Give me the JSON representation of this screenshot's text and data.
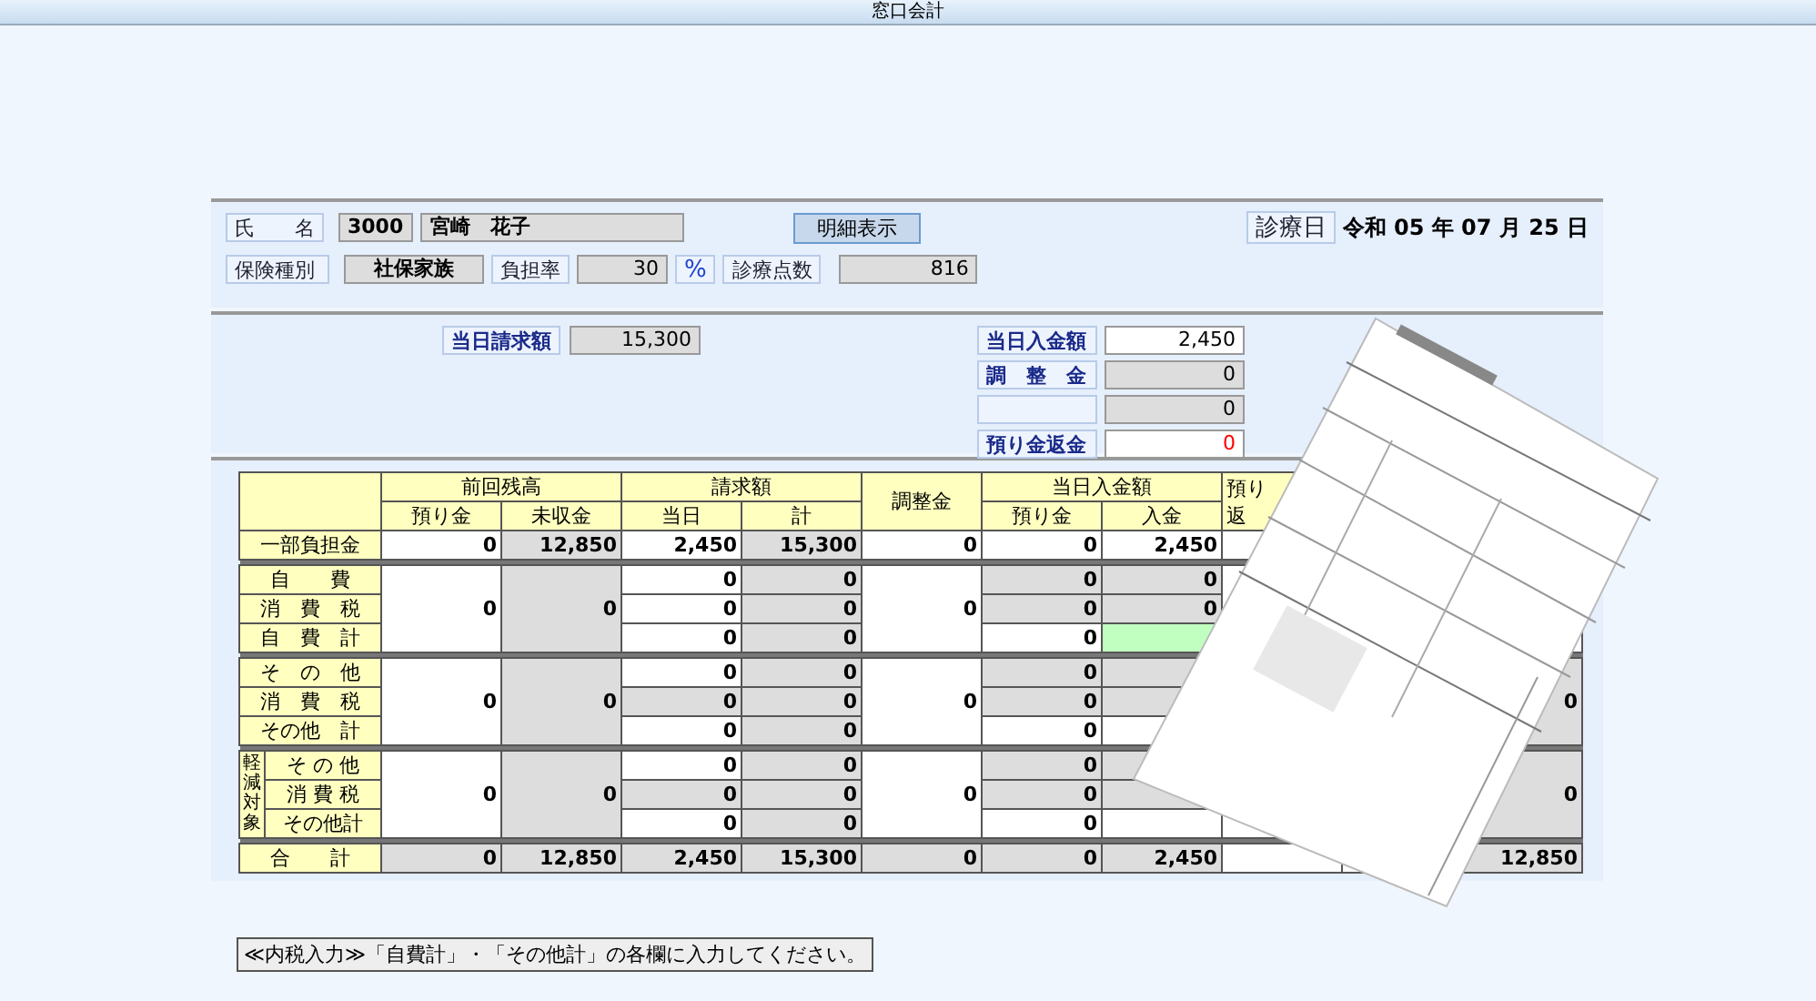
{
  "window": {
    "title": "窓口会計"
  },
  "patient": {
    "name_label": "氏　　名",
    "id": "3000",
    "name": "宮崎　花子",
    "detail_button": "明細表示",
    "date_label": "診療日",
    "date": "令和 05 年 07 月 25 日",
    "insurance_label": "保険種別",
    "insurance": "社保家族",
    "rate_label": "負担率",
    "rate": "30",
    "rate_unit": "%",
    "points_label": "診療点数",
    "points": "816"
  },
  "billing": {
    "label": "当日請求額",
    "value": "15,300"
  },
  "payments": [
    {
      "label": "当日入金額",
      "value": "2,450",
      "editable": true,
      "color": "#000000"
    },
    {
      "label": "調　整　金",
      "value": "0",
      "editable": false,
      "color": "#000000"
    },
    {
      "value": "0",
      "editable": false,
      "color": "#000000"
    },
    {
      "label": "預り金返金",
      "value": "0",
      "editable": true,
      "color": "#ff0000"
    }
  ],
  "table": {
    "header_groups": [
      {
        "label": "前回残高",
        "columns": [
          "預り金",
          "未収金"
        ]
      },
      {
        "label": "請求額",
        "columns": [
          "当日",
          "計"
        ]
      },
      {
        "label": "調整金"
      },
      {
        "label": "当日入金額",
        "columns": [
          "預り金",
          "入金"
        ]
      },
      {
        "lines": [
          "預り",
          "返"
        ]
      }
    ],
    "rows": [
      {
        "kind": "single",
        "label": "一部負担金",
        "cells": [
          {
            "value": "0",
            "shaded": false
          },
          {
            "value": "12,850",
            "shaded": true
          },
          {
            "value": "2,450",
            "shaded": false
          },
          {
            "value": "15,300",
            "shaded": true
          },
          {
            "value": "0",
            "shaded": false
          },
          {
            "value": "0",
            "shaded": false
          },
          {
            "value": "2,450",
            "shaded": false
          },
          null,
          null,
          null
        ]
      },
      {
        "kind": "group",
        "labels": [
          "自　　費",
          "消　費　税",
          "自　費　計"
        ],
        "merged": [
          {
            "value": "0",
            "shaded": false
          },
          {
            "value": "0",
            "shaded": true
          }
        ],
        "adjust": {
          "value": "0",
          "shaded": false
        },
        "lines": [
          [
            {
              "value": "0",
              "shaded": false
            },
            {
              "value": "0",
              "shaded": true
            },
            {
              "value": "0",
              "shaded": true
            },
            {
              "value": "0",
              "shaded": true
            }
          ],
          [
            {
              "value": "0",
              "shaded": false
            },
            {
              "value": "0",
              "shaded": true
            },
            {
              "value": "0",
              "shaded": true
            },
            {
              "value": "0",
              "shaded": true
            }
          ],
          [
            {
              "value": "0",
              "shaded": false
            },
            {
              "value": "0",
              "shaded": true
            },
            {
              "value": "0",
              "shaded": false
            },
            {
              "highlight": true
            }
          ]
        ],
        "end": null
      },
      {
        "kind": "group",
        "labels": [
          "そ　の　他",
          "消　費　税",
          "その他　計"
        ],
        "merged": [
          {
            "value": "0",
            "shaded": false
          },
          {
            "value": "0",
            "shaded": true
          }
        ],
        "adjust": {
          "value": "0",
          "shaded": false
        },
        "lines": [
          [
            {
              "value": "0",
              "shaded": false
            },
            {
              "value": "0",
              "shaded": true
            },
            {
              "value": "0",
              "shaded": true
            },
            {
              "shaded": true
            }
          ],
          [
            {
              "value": "0",
              "shaded": true
            },
            {
              "value": "0",
              "shaded": true
            },
            {
              "value": "0",
              "shaded": true
            },
            {
              "shaded": true
            }
          ],
          [
            {
              "value": "0",
              "shaded": false
            },
            {
              "value": "0",
              "shaded": true
            },
            {
              "value": "0",
              "shaded": false
            },
            {
              "shaded": false
            }
          ]
        ],
        "end": {
          "value": "0",
          "shaded": true
        }
      },
      {
        "kind": "group",
        "side_label": "軽減対象",
        "labels": [
          "そ の 他",
          "消 費 税",
          "その他計"
        ],
        "merged": [
          {
            "value": "0",
            "shaded": false
          },
          {
            "value": "0",
            "shaded": true
          }
        ],
        "adjust": {
          "value": "0",
          "shaded": false
        },
        "lines": [
          [
            {
              "value": "0",
              "shaded": false
            },
            {
              "value": "0",
              "shaded": true
            },
            {
              "value": "0",
              "shaded": true
            },
            {
              "shaded": true
            }
          ],
          [
            {
              "value": "0",
              "shaded": true
            },
            {
              "value": "0",
              "shaded": true
            },
            {
              "value": "0",
              "shaded": true
            },
            {
              "shaded": true
            }
          ],
          [
            {
              "value": "0",
              "shaded": false
            },
            {
              "value": "0",
              "shaded": true
            },
            {
              "value": "0",
              "shaded": false
            },
            {
              "shaded": false
            }
          ]
        ],
        "end": {
          "value": "0",
          "shaded": true
        }
      },
      {
        "kind": "single",
        "label": "合　　計",
        "cells": [
          {
            "value": "0",
            "shaded": true
          },
          {
            "value": "12,850",
            "shaded": true
          },
          {
            "value": "2,450",
            "shaded": true
          },
          {
            "value": "15,300",
            "shaded": true
          },
          {
            "value": "0",
            "shaded": true
          },
          {
            "value": "0",
            "shaded": true
          },
          {
            "value": "2,450",
            "shaded": true
          },
          null,
          null,
          {
            "value": "12,850",
            "shaded": true
          }
        ]
      }
    ]
  },
  "message": "≪内税入力≫「自費計」・「その他計」の各欄に入力してください。"
}
